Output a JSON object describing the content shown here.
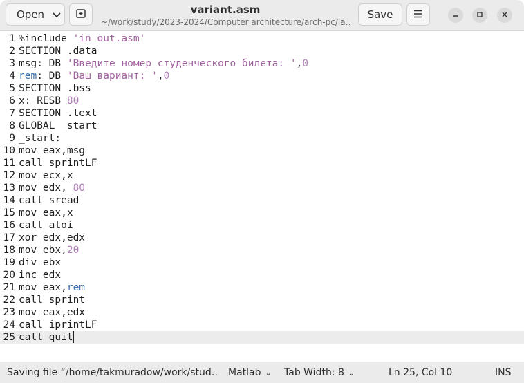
{
  "window": {
    "title": "variant.asm",
    "subtitle": "~/work/study/2023-2024/Computer architecture/arch-pc/la…"
  },
  "header": {
    "open_label": "Open",
    "open_icon": "chevron-down-icon",
    "new_tab_icon": "new-tab-icon",
    "save_label": "Save",
    "menu_icon": "hamburger-menu-icon",
    "min_icon": "minimize-icon",
    "max_icon": "maximize-icon",
    "close_icon": "close-icon"
  },
  "editor": {
    "current_line": 25,
    "lines": [
      {
        "n": "1",
        "parts": [
          {
            "t": "%include ",
            "c": ""
          },
          {
            "t": "'in_out.asm'",
            "c": "str"
          }
        ]
      },
      {
        "n": "2",
        "parts": [
          {
            "t": "SECTION .data",
            "c": ""
          }
        ]
      },
      {
        "n": "3",
        "parts": [
          {
            "t": "msg: DB ",
            "c": ""
          },
          {
            "t": "'Введите номер студенческого билета: '",
            "c": "str"
          },
          {
            "t": ",",
            "c": ""
          },
          {
            "t": "0",
            "c": "num"
          }
        ]
      },
      {
        "n": "4",
        "parts": [
          {
            "t": "rem",
            "c": "kw"
          },
          {
            "t": ": DB ",
            "c": ""
          },
          {
            "t": "'Ваш вариант: '",
            "c": "str"
          },
          {
            "t": ",",
            "c": ""
          },
          {
            "t": "0",
            "c": "num"
          }
        ]
      },
      {
        "n": "5",
        "parts": [
          {
            "t": "SECTION .bss",
            "c": ""
          }
        ]
      },
      {
        "n": "6",
        "parts": [
          {
            "t": "x: RESB ",
            "c": ""
          },
          {
            "t": "80",
            "c": "num"
          }
        ]
      },
      {
        "n": "7",
        "parts": [
          {
            "t": "SECTION .text",
            "c": ""
          }
        ]
      },
      {
        "n": "8",
        "parts": [
          {
            "t": "GLOBAL _start",
            "c": ""
          }
        ]
      },
      {
        "n": "9",
        "parts": [
          {
            "t": "_start:",
            "c": ""
          }
        ]
      },
      {
        "n": "10",
        "parts": [
          {
            "t": "mov eax,msg",
            "c": ""
          }
        ]
      },
      {
        "n": "11",
        "parts": [
          {
            "t": "call sprintLF",
            "c": ""
          }
        ]
      },
      {
        "n": "12",
        "parts": [
          {
            "t": "mov ecx,x",
            "c": ""
          }
        ]
      },
      {
        "n": "13",
        "parts": [
          {
            "t": "mov edx, ",
            "c": ""
          },
          {
            "t": "80",
            "c": "num"
          }
        ]
      },
      {
        "n": "14",
        "parts": [
          {
            "t": "call sread",
            "c": ""
          }
        ]
      },
      {
        "n": "15",
        "parts": [
          {
            "t": "mov eax,x",
            "c": ""
          }
        ]
      },
      {
        "n": "16",
        "parts": [
          {
            "t": "call atoi",
            "c": ""
          }
        ]
      },
      {
        "n": "17",
        "parts": [
          {
            "t": "xor edx,edx",
            "c": ""
          }
        ]
      },
      {
        "n": "18",
        "parts": [
          {
            "t": "mov ebx,",
            "c": ""
          },
          {
            "t": "20",
            "c": "num"
          }
        ]
      },
      {
        "n": "19",
        "parts": [
          {
            "t": "div ebx",
            "c": ""
          }
        ]
      },
      {
        "n": "20",
        "parts": [
          {
            "t": "inc edx",
            "c": ""
          }
        ]
      },
      {
        "n": "21",
        "parts": [
          {
            "t": "mov eax,",
            "c": ""
          },
          {
            "t": "rem",
            "c": "kw"
          }
        ]
      },
      {
        "n": "22",
        "parts": [
          {
            "t": "call sprint",
            "c": ""
          }
        ]
      },
      {
        "n": "23",
        "parts": [
          {
            "t": "mov eax,edx",
            "c": ""
          }
        ]
      },
      {
        "n": "24",
        "parts": [
          {
            "t": "call iprintLF",
            "c": ""
          }
        ]
      },
      {
        "n": "25",
        "parts": [
          {
            "t": "call quit",
            "c": ""
          }
        ]
      }
    ]
  },
  "status": {
    "message": "Saving file “/home/takmuradow/work/stud…",
    "language": "Matlab",
    "tab_width": "Tab Width: 8",
    "position": "Ln 25, Col 10",
    "mode": "INS"
  }
}
